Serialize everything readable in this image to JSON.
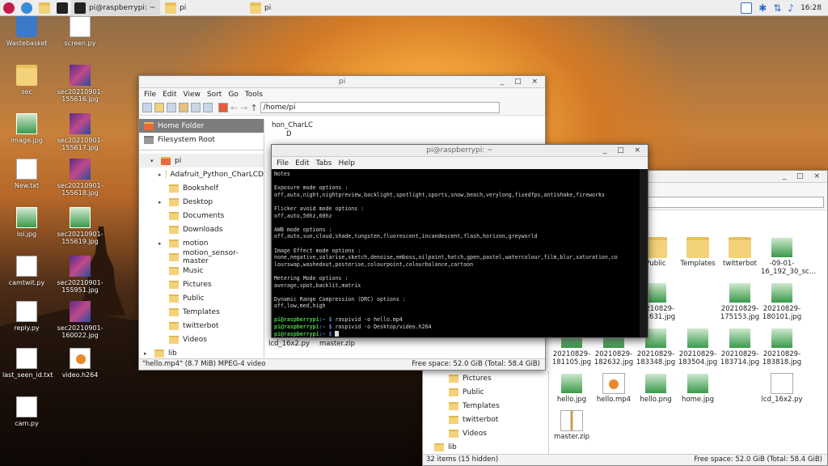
{
  "panel": {
    "tasks": [
      "pi@raspberrypi: ~",
      "pi",
      "pi"
    ],
    "clock": "16:28"
  },
  "desktop": {
    "icons": [
      {
        "label": "Wastebasket",
        "kind": "trash"
      },
      {
        "label": "screen.py",
        "kind": "doc"
      },
      {
        "label": "sec",
        "kind": "folder"
      },
      {
        "label": "sec20210901-155616.jpg",
        "kind": "pic"
      },
      {
        "label": "image.jpg",
        "kind": "img"
      },
      {
        "label": "sec20210901-155617.jpg",
        "kind": "pic"
      },
      {
        "label": "New.txt",
        "kind": "doc"
      },
      {
        "label": "sec20210901-155618.jpg",
        "kind": "pic"
      },
      {
        "label": "lol.jpg",
        "kind": "img"
      },
      {
        "label": "sec20210901-155619.jpg",
        "kind": "img"
      },
      {
        "label": "camtwit.py",
        "kind": "doc"
      },
      {
        "label": "sec20210901-155951.jpg",
        "kind": "pic"
      },
      {
        "label": "reply.py",
        "kind": "doc"
      },
      {
        "label": "sec20210901-160022.jpg",
        "kind": "pic"
      },
      {
        "label": "last_seen_id.txt",
        "kind": "doc"
      },
      {
        "label": "video.h264",
        "kind": "vid"
      },
      {
        "label": "cam.py",
        "kind": "doc"
      }
    ]
  },
  "fm1": {
    "title": "pi",
    "menu": [
      "File",
      "Edit",
      "View",
      "Sort",
      "Go",
      "Tools"
    ],
    "path": "/home/pi",
    "places": [
      "Home Folder",
      "Filesystem Root"
    ],
    "tree_root": "pi",
    "tree": [
      "Adafruit_Python_CharLCD",
      "Bookshelf",
      "Desktop",
      "Documents",
      "Downloads",
      "motion",
      "motion_sensor-master",
      "Music",
      "Pictures",
      "Public",
      "Templates",
      "twitterbot",
      "Videos",
      "lib"
    ],
    "partial_top": "hon_CharLC",
    "partial_top2": "D",
    "bottom_files": [
      "lcd_16x2.py",
      "master.zip"
    ],
    "status_left": "\"hello.mp4\" (8.7 MiB) MPEG-4 video",
    "status_right": "Free space: 52.0 GiB (Total: 58.4 GiB)"
  },
  "terminal": {
    "title": "pi@raspberrypi: ~",
    "menu": [
      "File",
      "Edit",
      "Tabs",
      "Help"
    ],
    "lines": [
      "Notes",
      "",
      "Exposure mode options :",
      "off,auto,night,nightpreview,backlight,spotlight,sports,snow,beach,verylong,fixedfps,antishake,fireworks",
      "",
      "Flicker avoid mode options :",
      "off,auto,50hz,60hz",
      "",
      "AWB mode options :",
      "off,auto,sun,cloud,shade,tungsten,fluorescent,incandescent,flash,horizon,greyworld",
      "",
      "Image Effect mode options :",
      "none,negative,solarise,sketch,denoise,emboss,oilpaint,hatch,gpen,pastel,watercolour,film,blur,saturation,co",
      "lourswap,washedout,posterise,colourpoint,colourbalance,cartoon",
      "",
      "Metering Mode options :",
      "average,spot,backlit,matrix",
      "",
      "Dynamic Range Compression (DRC) options :",
      "off,low,med,high",
      ""
    ],
    "prompt_user": "pi@raspberrypi",
    "prompt_path": ":~ $",
    "cmd1": " raspivid -o hello.mp4",
    "cmd2": " raspivid -o Desktop/video.h264"
  },
  "fm2": {
    "tree": [
      "Pictures",
      "Public",
      "Templates",
      "twitterbot",
      "Videos",
      "lib"
    ],
    "files": [
      {
        "label": "ctures",
        "kind": "folder"
      },
      {
        "label": "Public",
        "kind": "folder"
      },
      {
        "label": "Templates",
        "kind": "folder"
      },
      {
        "label": "twitterbot",
        "kind": "folder"
      },
      {
        "label": "20210829-172003.jpg",
        "kind": "img"
      },
      {
        "label": "20210829-172606.jpg",
        "kind": "img"
      },
      {
        "label": "20210829-174631.jpg",
        "kind": "img"
      },
      {
        "label": "20210829-175153.jpg",
        "kind": "img"
      },
      {
        "label": "20210829-180101.jpg",
        "kind": "img"
      },
      {
        "label": "20210829-181105.jpg",
        "kind": "img"
      },
      {
        "label": "20210829-182632.jpg",
        "kind": "img"
      },
      {
        "label": "20210829-183348.jpg",
        "kind": "img"
      },
      {
        "label": "20210829-183504.jpg",
        "kind": "img"
      },
      {
        "label": "20210829-183714.jpg",
        "kind": "img"
      },
      {
        "label": "20210829-183818.jpg",
        "kind": "img"
      },
      {
        "label": "hello.jpg",
        "kind": "img"
      },
      {
        "label": "hello.mp4",
        "kind": "vid"
      },
      {
        "label": "hello.png",
        "kind": "img"
      },
      {
        "label": "home.jpg",
        "kind": "img"
      },
      {
        "label": "lcd_16x2.py",
        "kind": "doc"
      },
      {
        "label": "master.zip",
        "kind": "zip"
      }
    ],
    "partial_file": "-09-01-16_192_30_sc...",
    "status_left": "32 items (15 hidden)",
    "status_right": "Free space: 52.0 GiB (Total: 58.4 GiB)"
  }
}
